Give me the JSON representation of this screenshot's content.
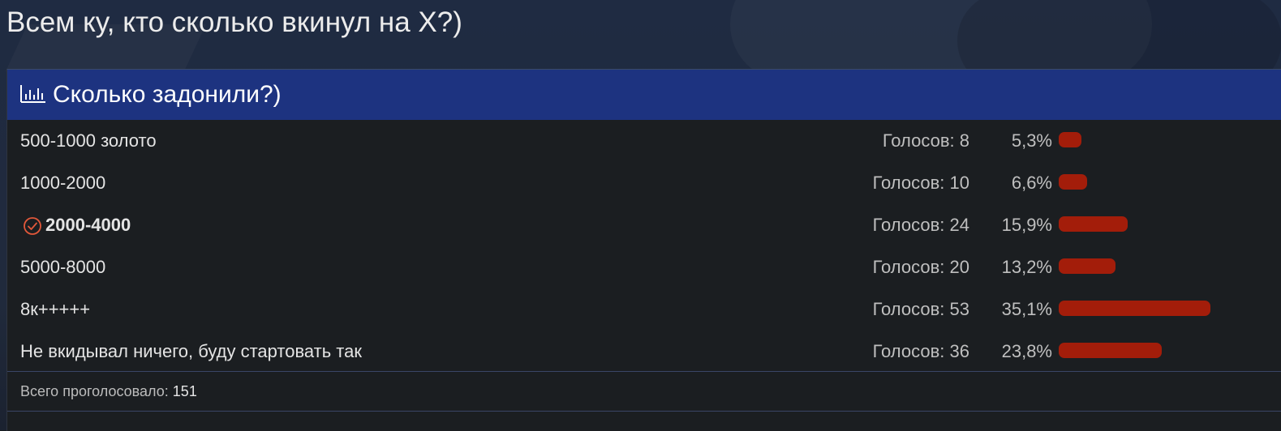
{
  "topic": {
    "title": "Всем ку, кто сколько вкинул на X?)"
  },
  "poll": {
    "icon": "bar-chart-icon",
    "title": "Сколько задонили?)",
    "accent_color": "#1d3380",
    "bar_color": "#a31d0a",
    "options": [
      {
        "label": "500-1000 золото",
        "votes_text": "Голосов: 8",
        "votes": 8,
        "percent_text": "5,3%",
        "percent": 5.3,
        "voted": false
      },
      {
        "label": "1000-2000",
        "votes_text": "Голосов: 10",
        "votes": 10,
        "percent_text": "6,6%",
        "percent": 6.6,
        "voted": false
      },
      {
        "label": "2000-4000",
        "votes_text": "Голосов: 24",
        "votes": 24,
        "percent_text": "15,9%",
        "percent": 15.9,
        "voted": true
      },
      {
        "label": "5000-8000",
        "votes_text": "Голосов: 20",
        "votes": 20,
        "percent_text": "13,2%",
        "percent": 13.2,
        "voted": false
      },
      {
        "label": "8к+++++",
        "votes_text": "Голосов: 53",
        "votes": 53,
        "percent_text": "35,1%",
        "percent": 35.1,
        "voted": false
      },
      {
        "label": "Не вкидывал ничего, буду стартовать так",
        "votes_text": "Голосов: 36",
        "votes": 36,
        "percent_text": "23,8%",
        "percent": 23.8,
        "voted": false
      }
    ],
    "footer": {
      "label": "Всего проголосовало:",
      "total": "151"
    }
  }
}
